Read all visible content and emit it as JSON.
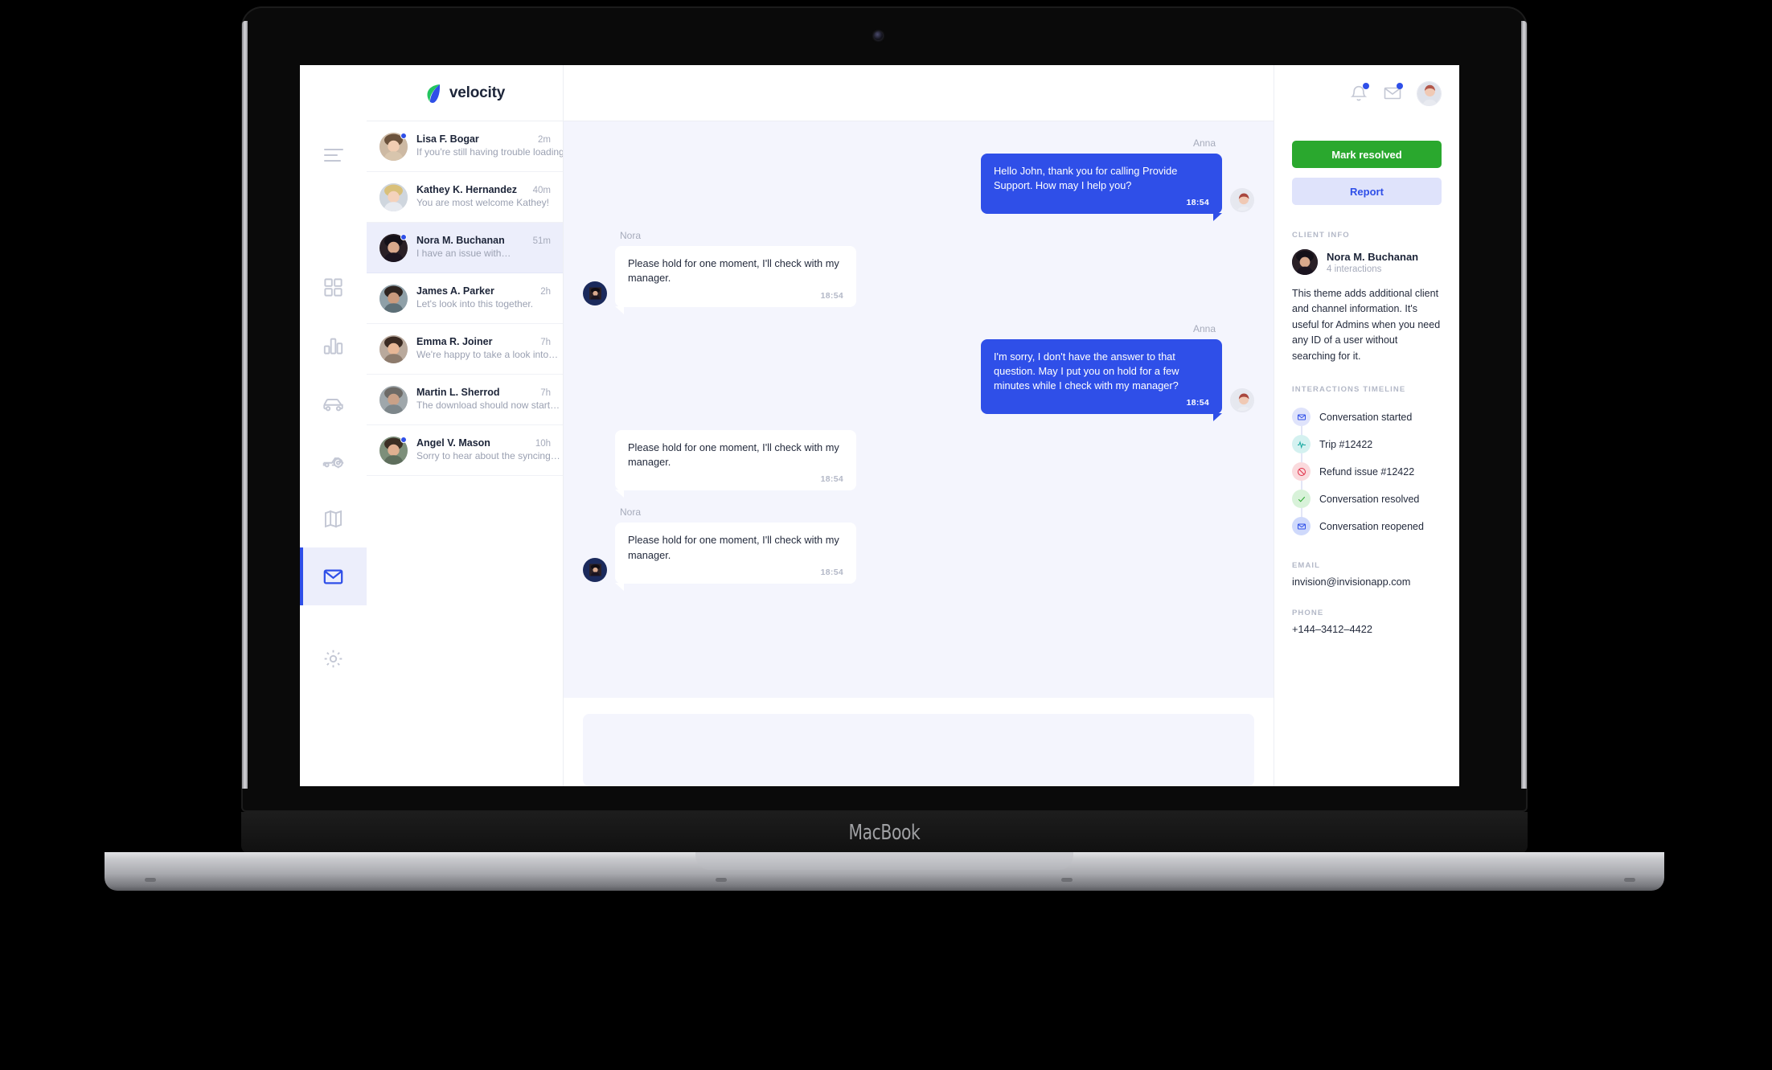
{
  "device": {
    "brand": "MacBook"
  },
  "rail": {
    "menu_icon": "hamburger-menu-icon",
    "items": [
      {
        "icon": "grid-dashboard-icon",
        "name": "dashboard",
        "active": false
      },
      {
        "icon": "bar-chart-icon",
        "name": "analytics",
        "active": false
      },
      {
        "icon": "car-icon",
        "name": "vehicles",
        "active": false
      },
      {
        "icon": "car-service-icon",
        "name": "service",
        "active": false
      },
      {
        "icon": "map-icon",
        "name": "map",
        "active": false
      },
      {
        "icon": "envelope-icon",
        "name": "inbox",
        "active": true
      },
      {
        "icon": "gear-icon",
        "name": "settings",
        "active": false
      }
    ]
  },
  "brand": {
    "name": "velocity",
    "mark_icon": "velocity-leaf-logo"
  },
  "conversations": [
    {
      "name": "Lisa F. Bogar",
      "preview": "If you're still having trouble loading…",
      "time": "2m",
      "unread": true,
      "selected": false
    },
    {
      "name": "Kathey K. Hernandez",
      "preview": "You are most welcome Kathey!",
      "time": "40m",
      "unread": false,
      "selected": false
    },
    {
      "name": "Nora M. Buchanan",
      "preview": "I have an issue with…",
      "time": "51m",
      "unread": true,
      "selected": true
    },
    {
      "name": "James A. Parker",
      "preview": "Let's look into this together.",
      "time": "2h",
      "unread": false,
      "selected": false
    },
    {
      "name": "Emma R. Joiner",
      "preview": "We're happy to take a look into…",
      "time": "7h",
      "unread": false,
      "selected": false
    },
    {
      "name": "Martin L. Sherrod",
      "preview": "The download should now start…",
      "time": "7h",
      "unread": false,
      "selected": false
    },
    {
      "name": "Angel V. Mason",
      "preview": "Sorry to hear about the syncing…",
      "time": "10h",
      "unread": true,
      "selected": false
    }
  ],
  "chat": {
    "blocks": [
      {
        "sender": "Anna",
        "side": "out",
        "avatar": "anna-avatar",
        "text": "Hello John, thank you for calling Provide Support. How may I help you?",
        "time": "18:54"
      },
      {
        "sender": "Nora",
        "side": "in",
        "avatar": "nora-avatar",
        "text": "Please hold for one moment, I'll check with my manager.",
        "time": "18:54"
      },
      {
        "sender": "Anna",
        "side": "out",
        "avatar": "anna-avatar",
        "text": "I'm sorry, I don't have the answer to that question. May I put you on hold for a few minutes while I check with my manager?",
        "time": "18:54"
      },
      {
        "sender": "",
        "side": "in",
        "avatar": "",
        "text": "Please hold for one moment, I'll check with my manager.",
        "time": "18:54"
      },
      {
        "sender": "Nora",
        "side": "in",
        "avatar": "nora-avatar",
        "text": "Please hold for one moment, I'll check with my manager.",
        "time": "18:54"
      }
    ],
    "composer_placeholder": ""
  },
  "header": {
    "notifications_icon": "bell-icon",
    "messages_icon": "envelope-icon",
    "avatar_icon": "user-avatar"
  },
  "panel": {
    "resolve_label": "Mark resolved",
    "report_label": "Report",
    "client_info_label": "Client info",
    "client": {
      "name": "Nora M. Buchanan",
      "interactions": "4 interactions",
      "description": "This theme adds additional client and channel information. It's useful for Admins when you need any ID of a user without searching for it."
    },
    "timeline_label": "Interactions timeline",
    "timeline": [
      {
        "text": "Conversation started",
        "icon": "envelope-icon",
        "bg": "#dfe3fb",
        "fg": "#2f4fe8"
      },
      {
        "text": "Trip #12422",
        "icon": "activity-icon",
        "bg": "#d4f1f0",
        "fg": "#16a8a0"
      },
      {
        "text": "Refund issue #12422",
        "icon": "block-icon",
        "bg": "#fadadd",
        "fg": "#e03048"
      },
      {
        "text": "Conversation resolved",
        "icon": "check-icon",
        "bg": "#d8f2d9",
        "fg": "#2aa82e"
      },
      {
        "text": "Conversation reopened",
        "icon": "envelope-icon",
        "bg": "#cfd9fb",
        "fg": "#2f4fe8"
      }
    ],
    "email_label": "Email",
    "email": "invision@invisionapp.com",
    "phone_label": "Phone",
    "phone": "+144–3412–4422"
  },
  "colors": {
    "accent_blue": "#2f4fe8",
    "green": "#2aa82e",
    "soft_blue_bg": "#dfe3fb",
    "chat_bg": "#f4f5fd",
    "selected_row": "#eceefb"
  }
}
